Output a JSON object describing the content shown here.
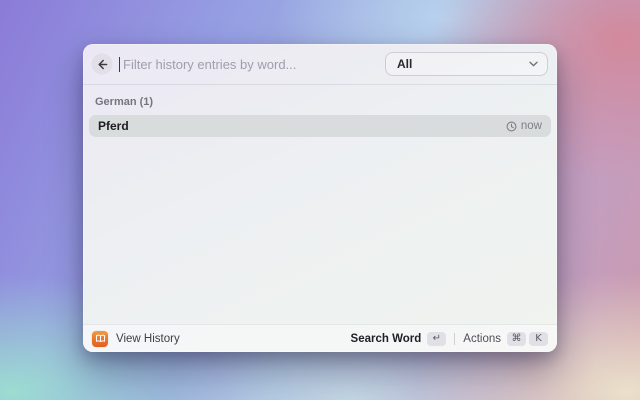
{
  "window": {
    "search_bar": {
      "placeholder": "Filter history entries by word...",
      "filter_dropdown": {
        "value": "All"
      }
    },
    "content": {
      "section_header": "German (1)",
      "items": [
        {
          "title": "Pferd",
          "time": "now",
          "selected": true
        }
      ]
    },
    "footer": {
      "command_name": "View History",
      "primary_action": {
        "label": "Search Word",
        "key": "↵"
      },
      "actions_menu": {
        "label": "Actions",
        "keys": [
          "⌘",
          "K"
        ]
      }
    },
    "icons": {
      "back": "arrow-left-icon",
      "dropdown": "chevron-down-icon",
      "item_time": "clock-icon",
      "app": "open-book-icon"
    },
    "colors": {
      "app_icon_orange": "#e7712b",
      "selection_gray": "#d9dcdc",
      "bg_purple": "#8b7bd8",
      "bg_pink": "#cf96a6",
      "bg_mint": "#9de0d1",
      "bg_cream": "#ece5cd"
    }
  }
}
